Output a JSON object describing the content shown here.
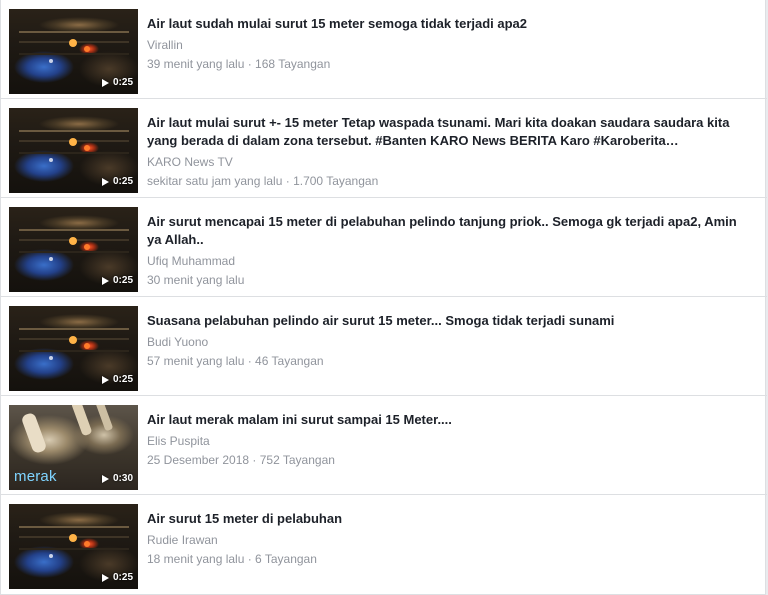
{
  "colors": {
    "title": "#1d2129",
    "secondary": "#90949c",
    "divider": "#dddfe2",
    "background": "#ffffff"
  },
  "videos": [
    {
      "title": "Air laut sudah mulai surut 15 meter semoga tidak terjadi apa2",
      "author": "Virallin",
      "meta": "39 menit yang lalu · 168 Tayangan",
      "duration": "0:25",
      "thumbnail_icon": "video-thumbnail"
    },
    {
      "title": "Air laut mulai surut +- 15 meter Tetap waspada tsunami. Mari kita doakan saudara saudara kita yang berada di dalam zona tersebut. #Banten KARO News BERITA Karo #Karoberita…",
      "author": "KARO News TV",
      "meta": "sekitar satu jam yang lalu · 1.700 Tayangan",
      "duration": "0:25",
      "thumbnail_icon": "video-thumbnail"
    },
    {
      "title": "Air surut mencapai 15 meter di pelabuhan pelindo tanjung priok.. Semoga gk terjadi apa2, Amin ya Allah..",
      "author": "Ufiq Muhammad",
      "meta": "30 menit yang lalu",
      "duration": "0:25",
      "thumbnail_icon": "video-thumbnail"
    },
    {
      "title": "Suasana pelabuhan pelindo air surut 15 meter... Smoga tidak terjadi sunami",
      "author": "Budi Yuono",
      "meta": "57 menit yang lalu · 46 Tayangan",
      "duration": "0:25",
      "thumbnail_icon": "video-thumbnail"
    },
    {
      "title": "Air laut merak malam ini surut sampai 15 Meter....",
      "author": "Elis Puspita",
      "meta": "25 Desember 2018 · 752 Tayangan",
      "duration": "0:30",
      "thumbnail_caption": "merak",
      "thumbnail_icon": "video-thumbnail"
    },
    {
      "title": "Air surut 15 meter di pelabuhan",
      "author": "Rudie Irawan",
      "meta": "18 menit yang lalu · 6 Tayangan",
      "duration": "0:25",
      "thumbnail_icon": "video-thumbnail"
    }
  ]
}
